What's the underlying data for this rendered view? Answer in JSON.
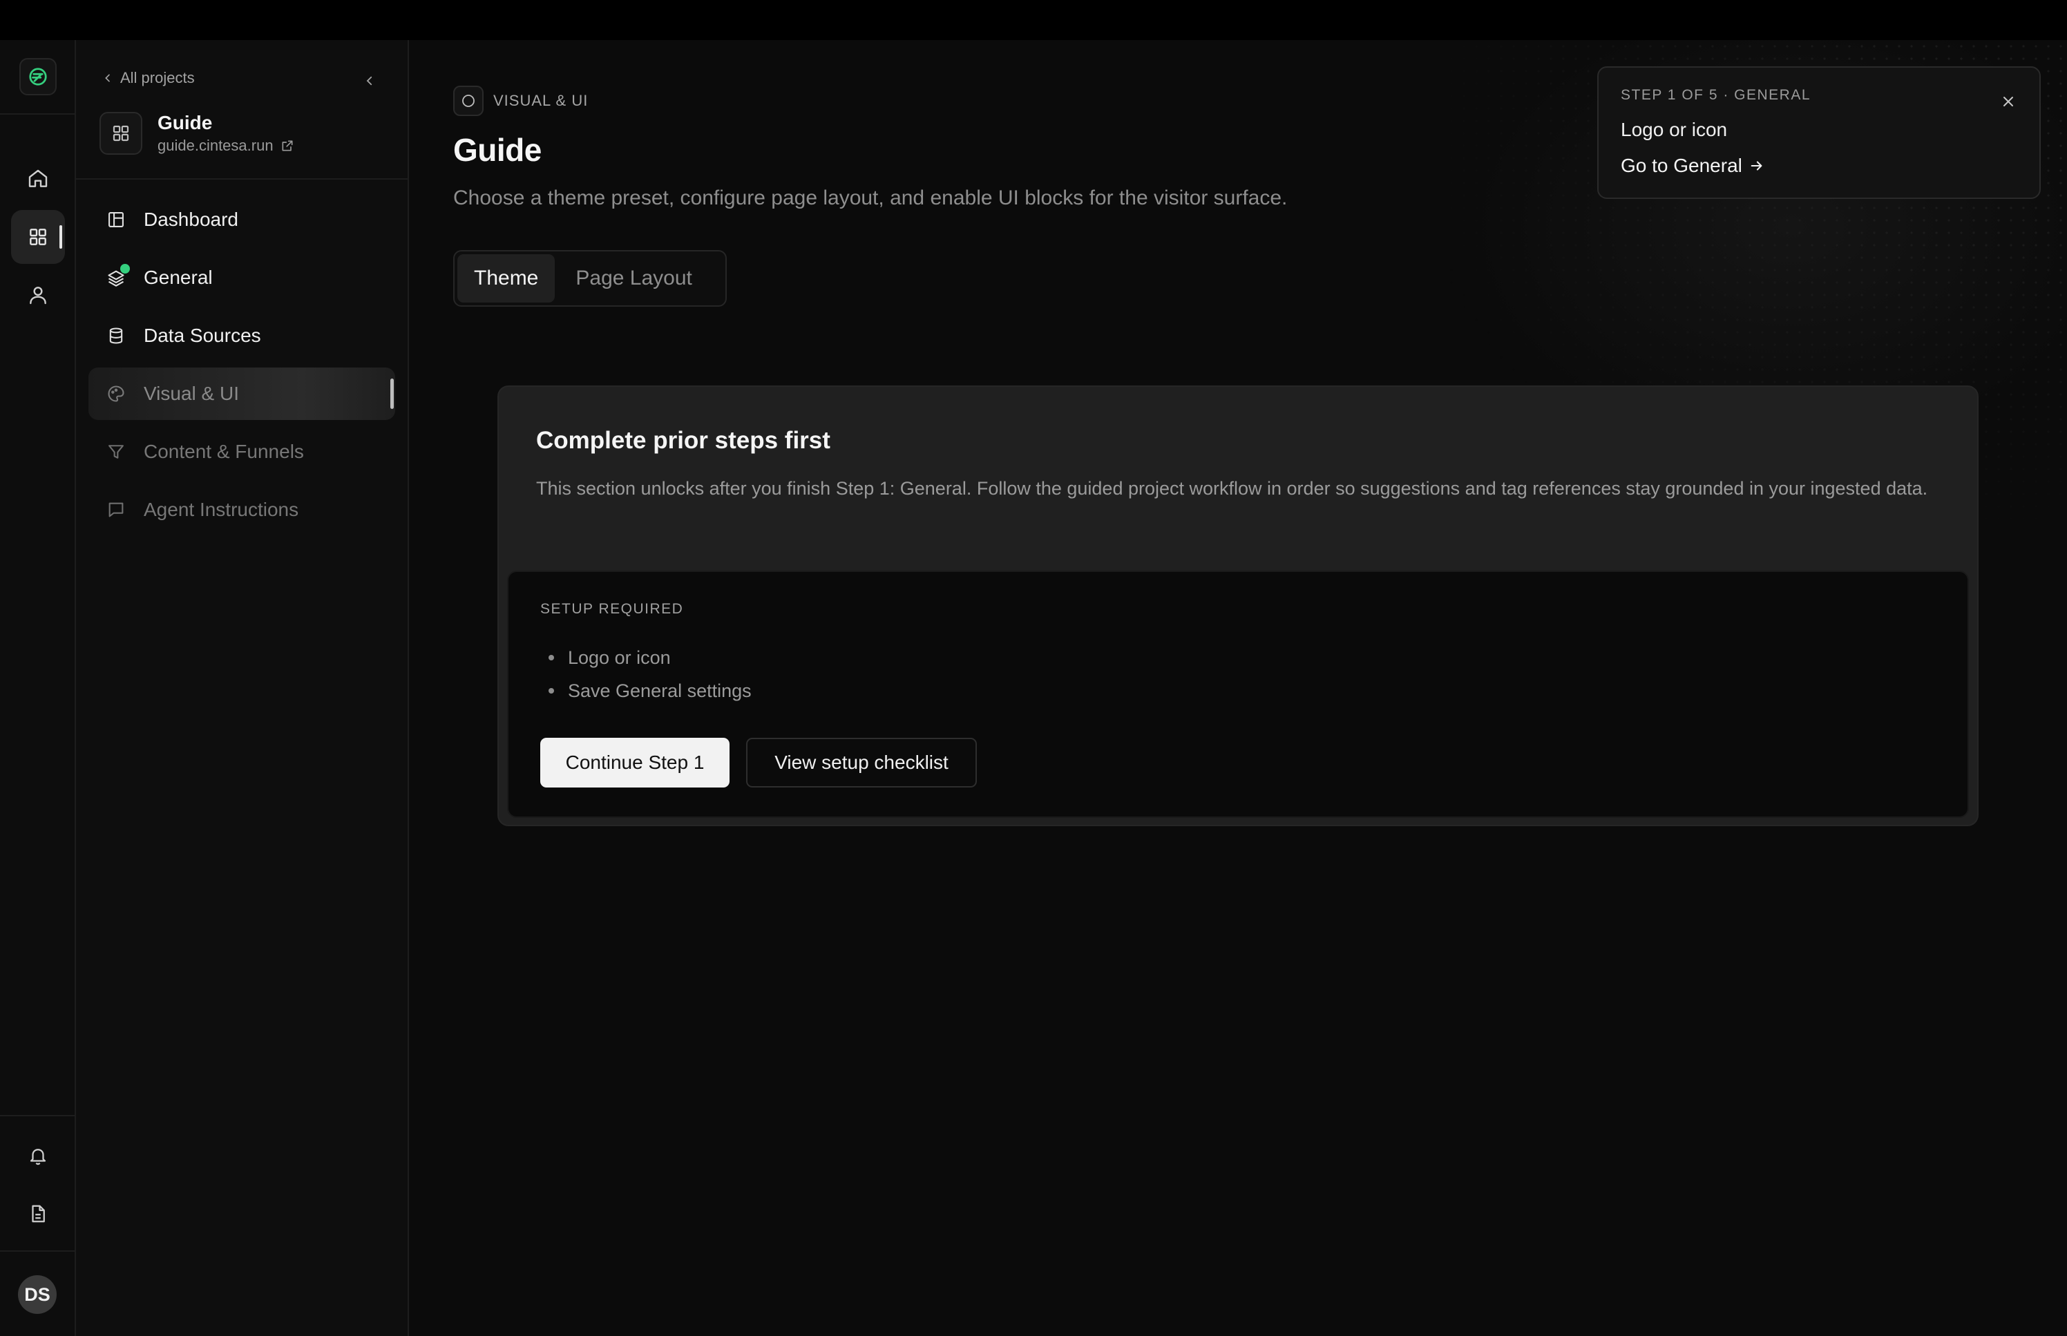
{
  "sidebar": {
    "back_label": "All projects",
    "project": {
      "name": "Guide",
      "url": "guide.cintesa.run"
    },
    "items": [
      {
        "label": "Dashboard",
        "icon": "layout-dashboard-icon"
      },
      {
        "label": "General",
        "icon": "layers-icon",
        "status": "complete"
      },
      {
        "label": "Data Sources",
        "icon": "database-icon"
      },
      {
        "label": "Visual & UI",
        "icon": "palette-icon",
        "active": true
      },
      {
        "label": "Content & Funnels",
        "icon": "funnel-icon"
      },
      {
        "label": "Agent Instructions",
        "icon": "message-square-icon"
      }
    ]
  },
  "rail": {
    "avatar_initials": "DS"
  },
  "header": {
    "section_label": "VISUAL & UI",
    "title": "Guide",
    "subtitle": "Choose a theme preset, configure page layout, and enable UI blocks for the visitor surface."
  },
  "tabs": [
    {
      "label": "Theme",
      "active": true
    },
    {
      "label": "Page Layout",
      "active": false
    }
  ],
  "gate_card": {
    "title": "Complete prior steps first",
    "description": "This section unlocks after you finish Step 1: General. Follow the guided project workflow in order so suggestions and tag references stay grounded in your ingested data.",
    "setup_label": "SETUP REQUIRED",
    "requirements": [
      "Logo or icon",
      "Save General settings"
    ],
    "primary_button": "Continue Step 1",
    "secondary_button": "View setup checklist"
  },
  "toast": {
    "step_label": "STEP 1 OF 5 · GENERAL",
    "item": "Logo or icon",
    "link_label": "Go to General"
  },
  "colors": {
    "background": "#0b0b0b",
    "surface": "#202020",
    "accent_green": "#35d07f",
    "primary_button": "#f2f2f2"
  }
}
